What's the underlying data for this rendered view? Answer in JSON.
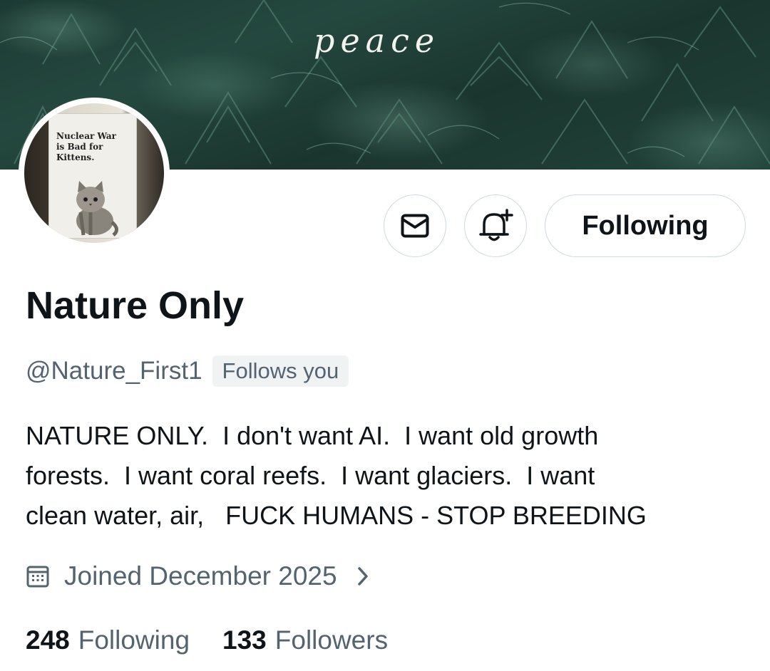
{
  "banner": {
    "word": "peace"
  },
  "avatar": {
    "poster_text": [
      "Nuclear War",
      "is Bad for",
      "Kittens."
    ]
  },
  "actions": {
    "message_icon": "envelope-icon",
    "notify_icon": "bell-plus-icon",
    "follow_label": "Following"
  },
  "profile": {
    "display_name": "Nature Only",
    "handle": "@Nature_First1",
    "follows_you": "Follows you",
    "bio": "NATURE ONLY.  I don't want AI.  I want old growth\nforests.  I want coral reefs.  I want glaciers.  I want\nclean water, air,   FUCK HUMANS - STOP BREEDING",
    "joined": "Joined December 2025",
    "joined_icon": "calendar-icon"
  },
  "stats": {
    "following_count": "248",
    "following_label": "Following",
    "followers_count": "133",
    "followers_label": "Followers"
  },
  "colors": {
    "text_primary": "#0f1419",
    "text_secondary": "#536471",
    "border": "#cfd9de",
    "badge_bg": "#eff3f4"
  }
}
